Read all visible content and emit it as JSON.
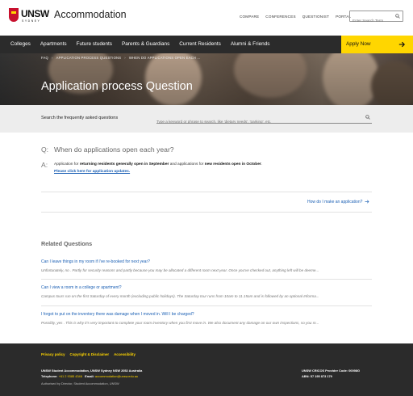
{
  "brand": {
    "logo_word": "UNSW",
    "logo_sub": "SYDNEY",
    "site_title": "Accommodation"
  },
  "top_links": [
    "COMPARE",
    "CONFERENCES",
    "QUESTIONIST",
    "PORTAL"
  ],
  "search": {
    "placeholder": "Enter Search Term"
  },
  "nav": {
    "items": [
      "Colleges",
      "Apartments",
      "Future students",
      "Parents & Guardians",
      "Current Residents",
      "Alumni & Friends"
    ],
    "apply_label": "Apply Now"
  },
  "breadcrumb": [
    "FAQ",
    "APPLICATION PROCESS QUESTIONS",
    "WHEN DO APPLICATIONS OPEN EACH ..."
  ],
  "page_title": "Application process Question",
  "faq_search": {
    "label": "Search the frequently asked questions",
    "placeholder": "Type a keyword or phrase to search, like 'dietary needs', 'parking', etc."
  },
  "question": {
    "q_letter": "Q:",
    "text": "When do applications open each year?",
    "a_letter": "A:",
    "answer_part1": "Application for ",
    "answer_bold1": "returning residents generally open in September",
    "answer_part2": " and applications for ",
    "answer_bold2": "new residents open in October",
    "answer_part3": ".",
    "link": "Please click here for application updates."
  },
  "next_question": "How do I make an application?",
  "related": {
    "title": "Related Questions",
    "items": [
      {
        "question": "Can I leave things in my room if I've re-booked for next year?",
        "excerpt": "Unfortunately, no . Partly for security reasons and partly because you may be allocated a different room next year. Once you've checked out, anything left will be deeme..."
      },
      {
        "question": "Can I view a room in a college or apartment?",
        "excerpt": "Campus tours run on the first Saturday of every month (excluding public holidays). The Saturday tour runs from 10am to 11.15am and is followed by an optional Informa..."
      },
      {
        "question": "I forgot to put on the inventory there was damage when I moved in. Will I be charged?",
        "excerpt": "Possibly, yes . This is why it's very important to complete your room inventory when you first move in. We also document any damage on our own inspections, so you m..."
      }
    ]
  },
  "footer": {
    "links": [
      "Privacy policy",
      "Copyright & Disclaimer",
      "Accessibility"
    ],
    "address_line": "UNSW Student Accommodation, UNSW Sydney NSW 2052 Australia",
    "telephone_label": "Telephone:",
    "telephone": "+61 2 9385 4346",
    "email_label": "Email:",
    "email": "accommodation@unsw.edu.au",
    "cricos": "UNSW CRICOS Provider Code:  00098G",
    "abn": "ABN:  57 195 873 179",
    "authorised": "Authorised by Director, Student Accommodation, UNSW"
  },
  "colors": {
    "accent_yellow": "#ffd600",
    "nav_dark": "#2b2b2b",
    "link_blue": "#1a5fb4",
    "unsw_red": "#c8102e"
  }
}
